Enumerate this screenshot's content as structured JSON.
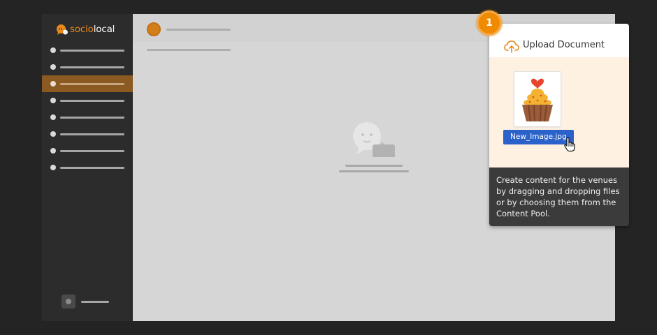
{
  "app": {
    "logo": {
      "prefix": "socio",
      "suffix": "local"
    }
  },
  "sidebar": {
    "items": [
      {
        "id": "item-1",
        "active": false
      },
      {
        "id": "item-2",
        "active": false
      },
      {
        "id": "item-3",
        "active": true
      },
      {
        "id": "item-4",
        "active": false
      },
      {
        "id": "item-5",
        "active": false
      },
      {
        "id": "item-6",
        "active": false
      },
      {
        "id": "item-7",
        "active": false
      },
      {
        "id": "item-8",
        "active": false
      }
    ]
  },
  "onboarding": {
    "step": "1",
    "title": "Upload Document",
    "file_name": "New_Image.jpg",
    "description": "Create content for the venues by dragging and dropping files or by choosing them from the Content Pool."
  },
  "colors": {
    "accent": "#f08a00",
    "brand_orange": "#e8891c",
    "active_nav": "#8a5a22",
    "chip_blue": "#2b62c9",
    "tooltip_dark": "#3b3b3b",
    "drop_zone": "#fef1e2"
  },
  "icons": {
    "upload": "cloud-upload-icon",
    "file": "cupcake-image-thumbnail",
    "cursor": "hand-pointer-icon",
    "empty": "chat-bubbles-icon"
  }
}
